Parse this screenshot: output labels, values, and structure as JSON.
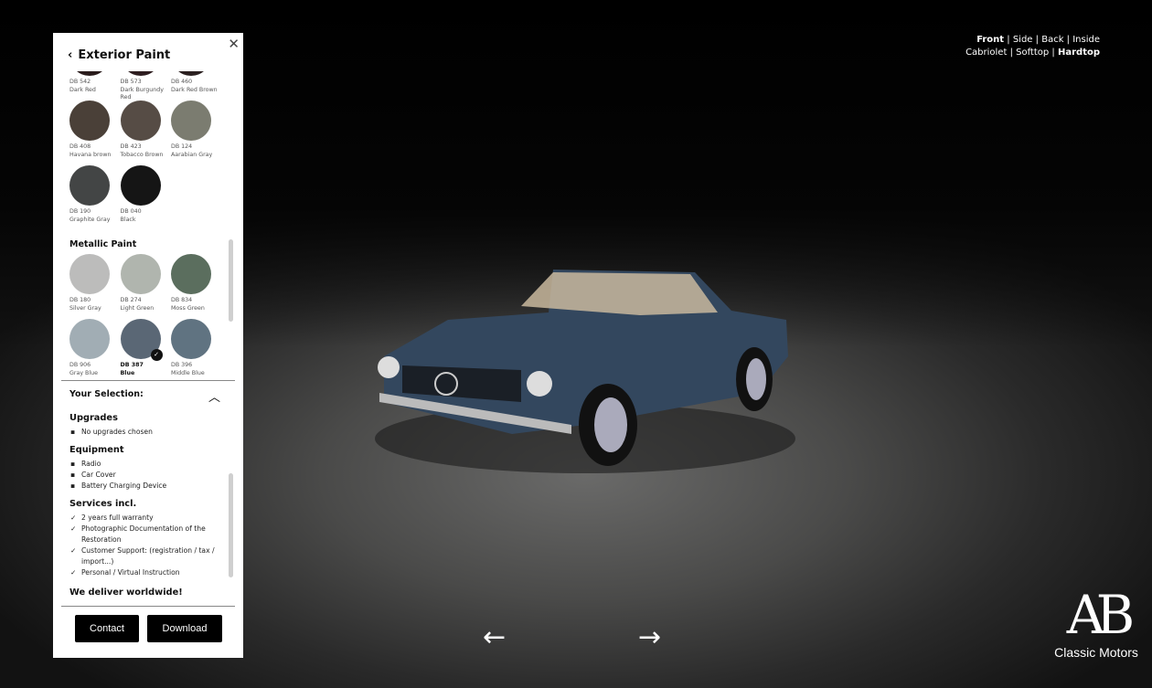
{
  "panel": {
    "title": "Exterior Paint",
    "metallic_heading": "Metallic Paint",
    "solid_swatches": [
      {
        "code": "DB 542",
        "name": "Dark Red",
        "color": "#2a1c1c"
      },
      {
        "code": "DB 573",
        "name": "Dark Burgundy Red",
        "color": "#2e1e20"
      },
      {
        "code": "DB 460",
        "name": "Dark Red Brown",
        "color": "#2b2020"
      },
      {
        "code": "DB 408",
        "name": "Havana brown",
        "color": "#4a4038"
      },
      {
        "code": "DB 423",
        "name": "Tobacco Brown",
        "color": "#564c45"
      },
      {
        "code": "DB 124",
        "name": "Aarabian Gray",
        "color": "#7b7c70"
      },
      {
        "code": "DB 190",
        "name": "Graphite Gray",
        "color": "#434545"
      },
      {
        "code": "DB 040",
        "name": "Black",
        "color": "#151515"
      }
    ],
    "metallic_swatches": [
      {
        "code": "DB 180",
        "name": "Silver Gray",
        "color": "#bcbcbb"
      },
      {
        "code": "DB 274",
        "name": "Light Green",
        "color": "#b0b5ae"
      },
      {
        "code": "DB 834",
        "name": "Moss Green",
        "color": "#5b6e5e"
      },
      {
        "code": "DB 906",
        "name": "Gray Blue",
        "color": "#a1adb4"
      },
      {
        "code": "DB 387",
        "name": "Blue",
        "color": "#5a6775",
        "selected": true
      },
      {
        "code": "DB 396",
        "name": "Middle Blue",
        "color": "#607381"
      }
    ],
    "selection": {
      "heading": "Your Selection:",
      "upgrades_heading": "Upgrades",
      "upgrades": [
        "No upgrades chosen"
      ],
      "equipment_heading": "Equipment",
      "equipment": [
        "Radio",
        "Car Cover",
        "Battery Charging Device"
      ],
      "services_heading": "Services incl.",
      "services": [
        "2 years full warranty",
        "Photographic Documentation of the Restoration",
        " Customer Support: (registration / tax / import...)",
        "Personal / Virtual Instruction"
      ],
      "deliver": "We deliver worldwide!"
    },
    "buttons": {
      "contact": "Contact",
      "download": "Download"
    }
  },
  "views": {
    "row1": [
      "Front",
      "Side",
      "Back",
      "Inside"
    ],
    "row2": [
      "Cabriolet",
      "Softtop",
      "Hardtop"
    ],
    "active": [
      "Front",
      "Hardtop"
    ]
  },
  "logo": {
    "mark": "AB",
    "text": "Classic Motors"
  },
  "car_color": "#33475e"
}
